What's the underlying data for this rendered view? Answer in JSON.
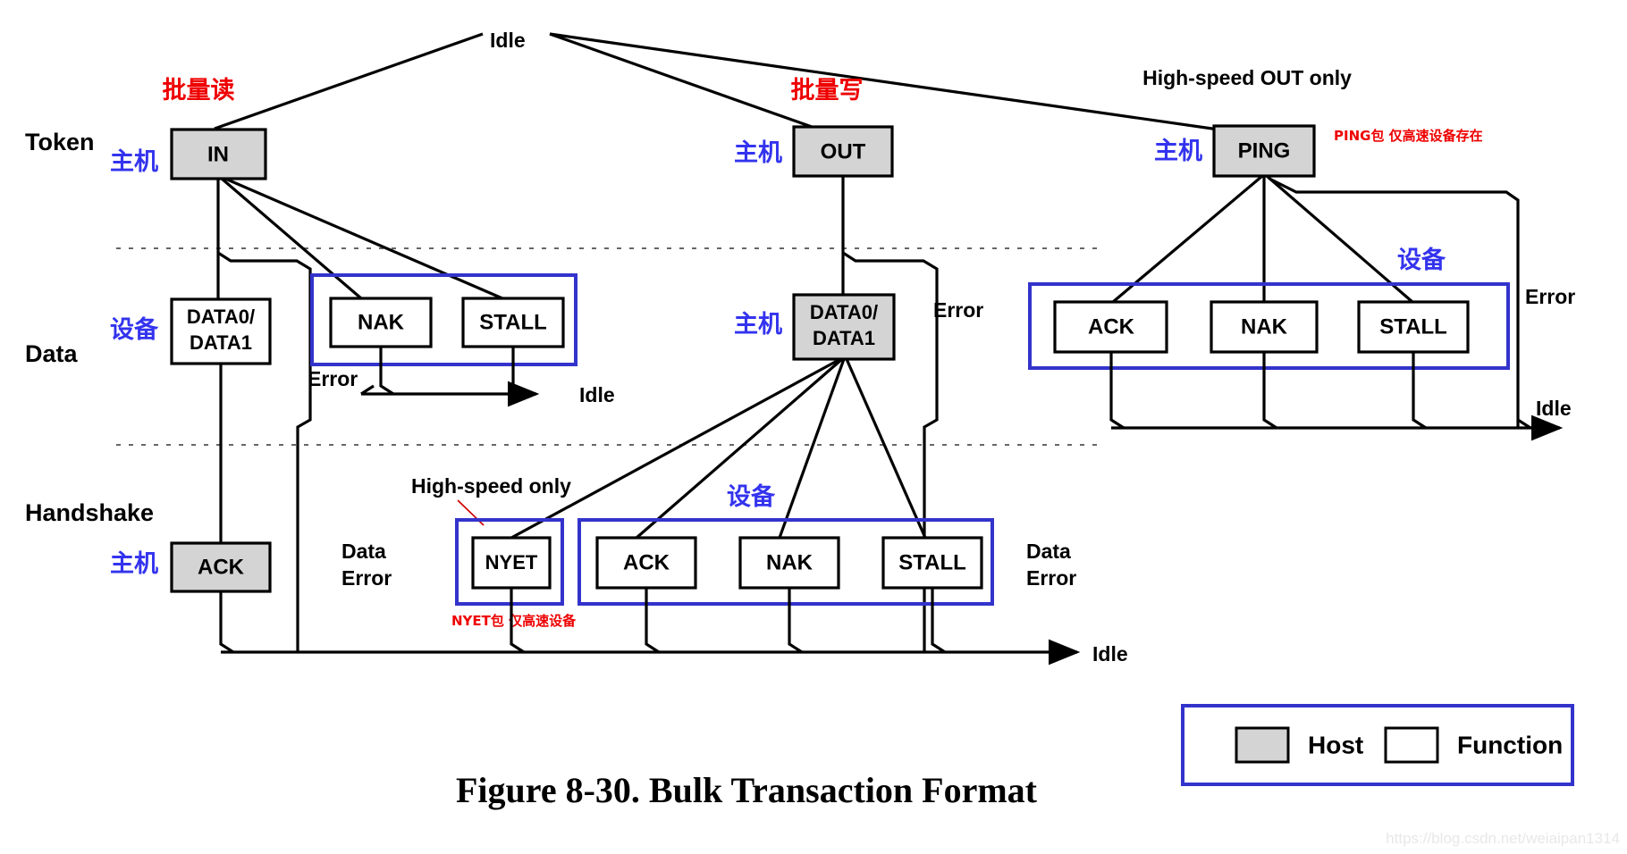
{
  "figure": {
    "caption": "Figure 8-30.  Bulk Transaction Format",
    "watermark": "https://blog.csdn.net/weiaipan1314"
  },
  "rows": {
    "token": "Token",
    "data": "Data",
    "handshake": "Handshake"
  },
  "legend": {
    "host_label": "Host",
    "function_label": "Function",
    "host_color": "#d4d4d4",
    "function_color": "#ffffff",
    "border_color": "#3333cc"
  },
  "idle_labels": {
    "top": "Idle",
    "left_mid": "Idle",
    "bottom_left": "Idle",
    "right": "Idle"
  },
  "annotations": {
    "bulk_read_cn": "批量读",
    "bulk_write_cn": "批量写",
    "high_speed_out_only": "High-speed OUT only",
    "ping_note_cn": "PING包 仅高速设备存在",
    "high_speed_only": "High-speed only",
    "nyet_note_cn": "NYET包 仅高速设备",
    "host_cn": "主机",
    "device_cn": "设备",
    "error": "Error",
    "data_error_line1": "Data",
    "data_error_line2": "Error"
  },
  "branches": {
    "bulk_read": {
      "token": {
        "label": "IN",
        "role": "host",
        "role_cn": "主机"
      },
      "data_primary": {
        "label_line1": "DATA0/",
        "label_line2": "DATA1",
        "role": "function",
        "role_cn": "设备"
      },
      "data_group": [
        {
          "label": "NAK",
          "role": "function"
        },
        {
          "label": "STALL",
          "role": "function"
        }
      ],
      "data_group_owner_cn": "设备",
      "handshake": {
        "label": "ACK",
        "role": "host",
        "role_cn": "主机"
      },
      "error_label": "Error",
      "data_error_label_line1": "Data",
      "data_error_label_line2": "Error"
    },
    "bulk_write": {
      "token": {
        "label": "OUT",
        "role": "host",
        "role_cn": "主机"
      },
      "data_primary": {
        "label_line1": "DATA0/",
        "label_line2": "DATA1",
        "role": "host",
        "role_cn": "主机"
      },
      "error_label": "Error",
      "handshake_hs": {
        "label": "NYET",
        "role": "function",
        "note": "High-speed only"
      },
      "handshake_group": [
        {
          "label": "ACK",
          "role": "function"
        },
        {
          "label": "NAK",
          "role": "function"
        },
        {
          "label": "STALL",
          "role": "function"
        }
      ],
      "handshake_group_owner_cn": "设备",
      "data_error_label_line1": "Data",
      "data_error_label_line2": "Error"
    },
    "ping": {
      "title": "High-speed OUT only",
      "token": {
        "label": "PING",
        "role": "host",
        "role_cn": "主机"
      },
      "note_cn": "PING包 仅高速设备存在",
      "data_group": [
        {
          "label": "ACK",
          "role": "function"
        },
        {
          "label": "NAK",
          "role": "function"
        },
        {
          "label": "STALL",
          "role": "function"
        }
      ],
      "data_group_owner_cn": "设备",
      "error_label": "Error"
    }
  }
}
